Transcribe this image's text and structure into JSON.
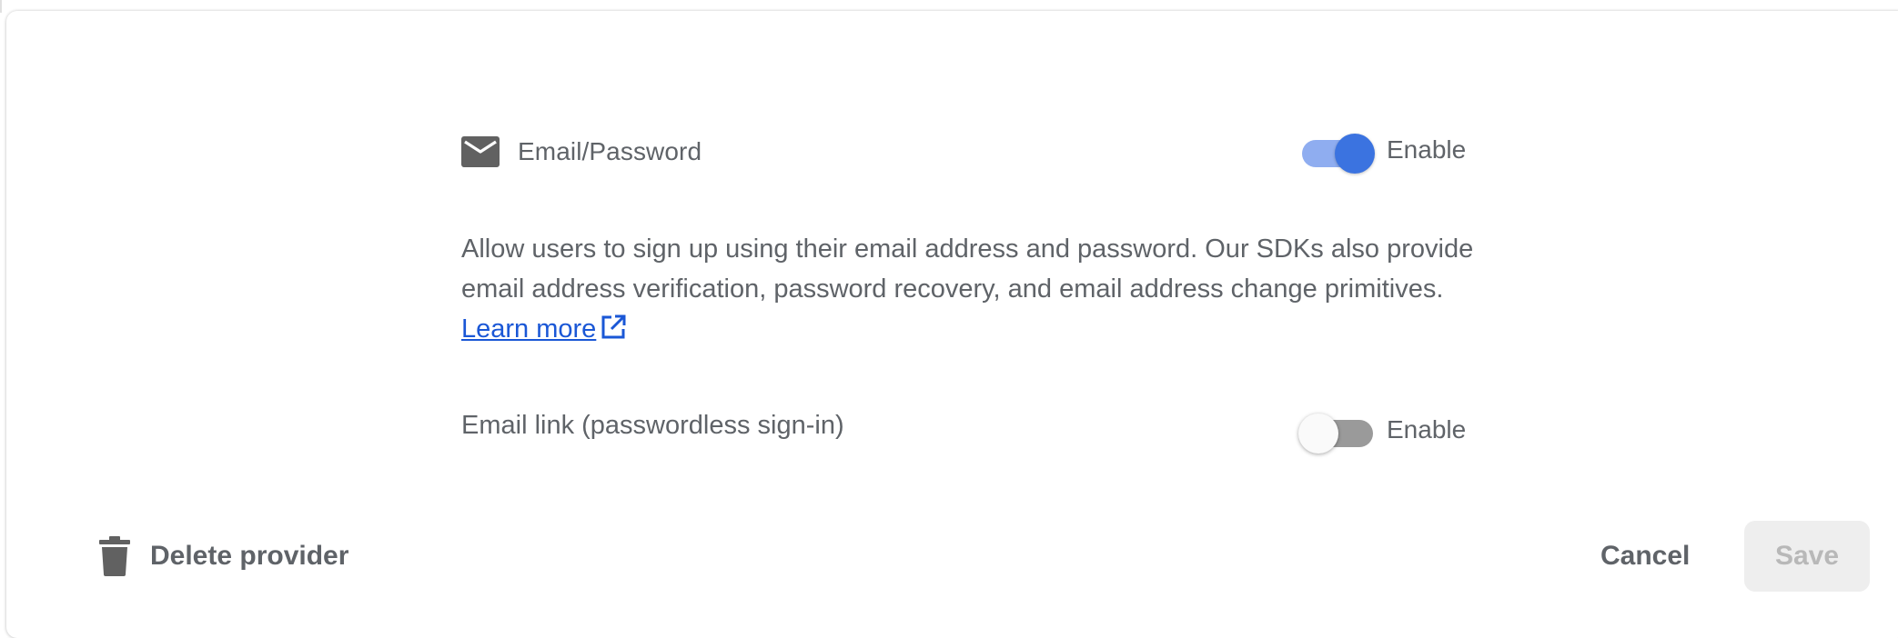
{
  "provider": {
    "icon": "mail-icon",
    "label": "Email/Password",
    "enabled": true,
    "toggle_label": "Enable"
  },
  "description": {
    "text": "Allow users to sign up using their email address and password. Our SDKs also provide email address verification, password recovery, and email address change primitives.",
    "link_label": "Learn more",
    "link_icon": "open-in-new-icon"
  },
  "email_link": {
    "label": "Email link (passwordless sign-in)",
    "enabled": false,
    "toggle_label": "Enable"
  },
  "footer": {
    "delete_icon": "trash-icon",
    "delete_label": "Delete provider",
    "cancel_label": "Cancel",
    "save_label": "Save",
    "save_disabled": true
  },
  "colors": {
    "accent": "#3b73e0",
    "accent_track": "#8fadf0",
    "link": "#1a57d6",
    "text": "#5f6368",
    "disabled_bg": "#eeeeee",
    "disabled_text": "#b8b8b8"
  }
}
